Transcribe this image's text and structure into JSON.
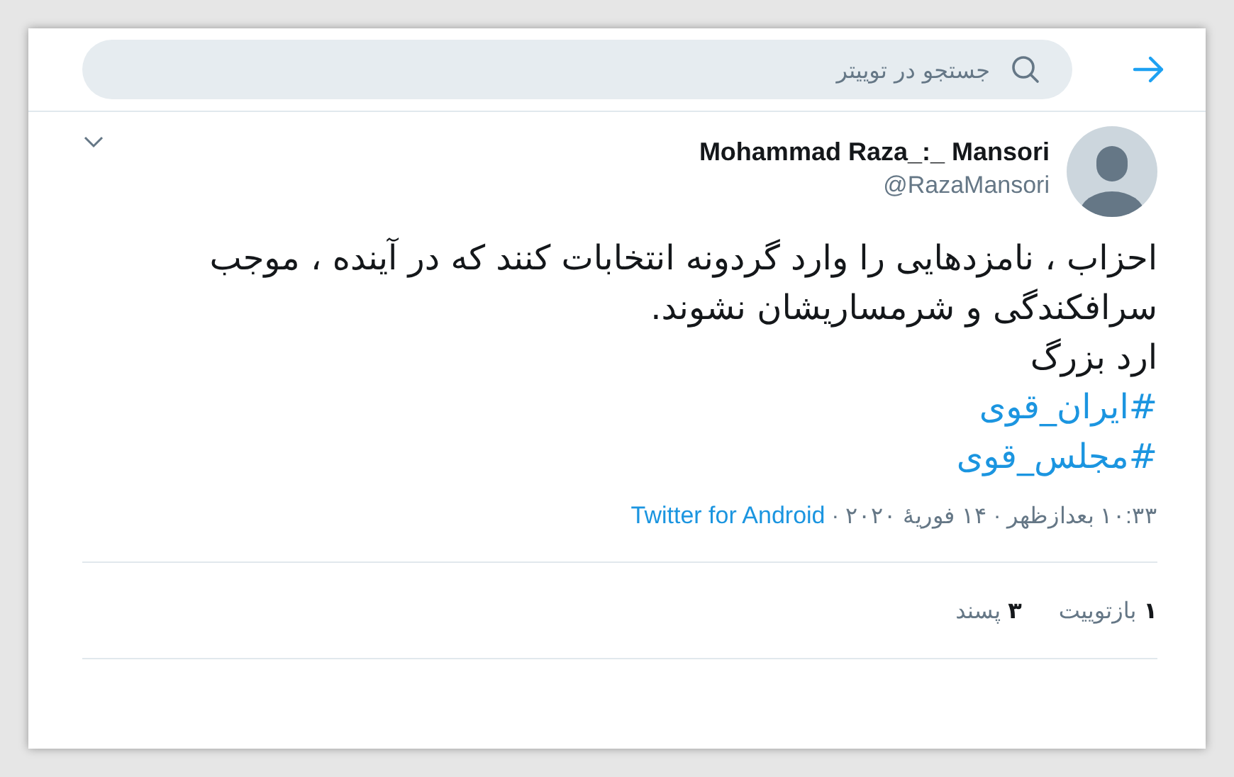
{
  "search": {
    "placeholder": "جستجو در توییتر"
  },
  "tweet": {
    "name": "Mohammad Raza_:_ Mansori",
    "handle": "@RazaMansori",
    "lines": [
      "احزاب ، نامزدهایی را وارد گردونه انتخابات کنند که در آینده ، موجب سرافکندگی و شرمساریشان نشوند.",
      "ارد بزرگ"
    ],
    "hashtags": [
      "#ایران_قوی",
      "#مجلس_قوی"
    ],
    "time": "۱۰:۳۳ بعدازظهر · ۱۴ فوریهٔ ۲۰۲۰ · ",
    "source": "Twitter for Android",
    "stats": [
      {
        "count": "۱",
        "label": "بازتوییت"
      },
      {
        "count": "۳",
        "label": "پسند"
      }
    ]
  }
}
